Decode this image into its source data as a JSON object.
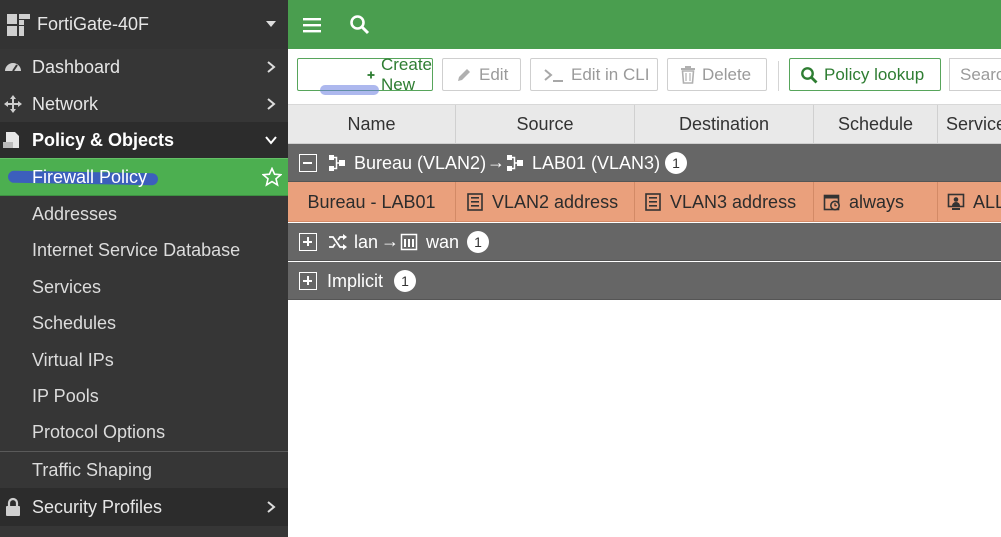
{
  "sidebar": {
    "device_name": "FortiGate-40F",
    "menu": [
      {
        "label": "Dashboard",
        "icon": "dashboard-icon"
      },
      {
        "label": "Network",
        "icon": "network-icon"
      },
      {
        "label": "Policy & Objects",
        "icon": "policy-icon"
      }
    ],
    "policy_items": [
      {
        "label": "Firewall Policy"
      },
      {
        "label": "Addresses"
      },
      {
        "label": "Internet Service Database"
      },
      {
        "label": "Services"
      },
      {
        "label": "Schedules"
      },
      {
        "label": "Virtual IPs"
      },
      {
        "label": "IP Pools"
      },
      {
        "label": "Protocol Options"
      },
      {
        "label": "Traffic Shaping"
      }
    ],
    "security_profiles": {
      "label": "Security Profiles",
      "icon": "lock-icon"
    }
  },
  "toolbar": {
    "create_new": "Create New",
    "edit": "Edit",
    "edit_cli": "Edit in CLI",
    "delete": "Delete",
    "policy_lookup": "Policy lookup",
    "search_placeholder": "Search"
  },
  "table": {
    "columns": [
      "Name",
      "Source",
      "Destination",
      "Schedule",
      "Service"
    ],
    "groups": [
      {
        "from": "Bureau (VLAN2)",
        "to": "LAB01 (VLAN3)",
        "count": "1",
        "expanded": true
      },
      {
        "from": "lan",
        "to": "wan",
        "count": "1",
        "expanded": false
      },
      {
        "label": "Implicit",
        "count": "1",
        "expanded": false
      }
    ],
    "rows": [
      {
        "name": "Bureau - LAB01",
        "source": "VLAN2 address",
        "destination": "VLAN3 address",
        "schedule": "always",
        "service": "ALL"
      }
    ]
  },
  "colors": {
    "accent_green": "#4a9e4f",
    "selected_row": "#eaa07c",
    "group_header": "#666666"
  }
}
